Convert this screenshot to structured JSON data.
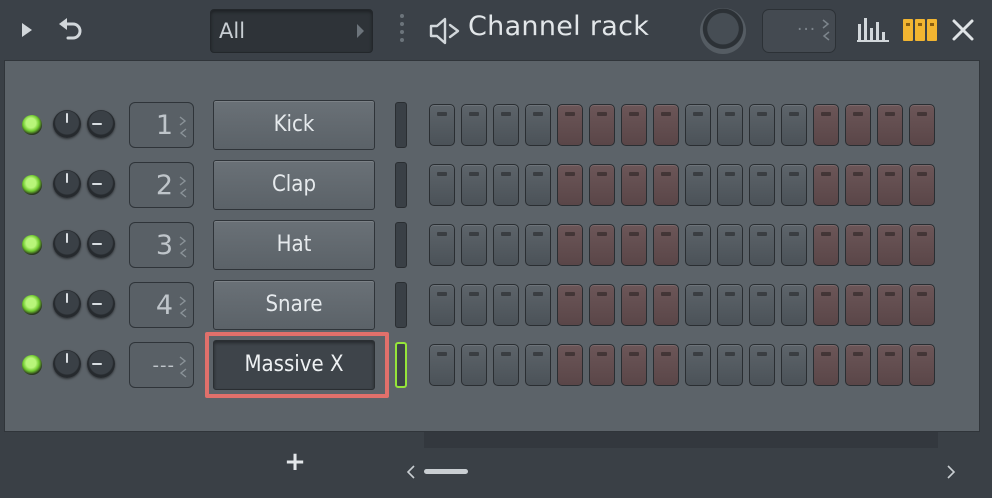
{
  "titlebar": {
    "filter_value": "All",
    "title": "Channel rack",
    "swing_value": "···"
  },
  "channels": [
    {
      "name": "Kick",
      "mixer_track": "1",
      "selected": false
    },
    {
      "name": "Clap",
      "mixer_track": "2",
      "selected": false
    },
    {
      "name": "Hat",
      "mixer_track": "3",
      "selected": false
    },
    {
      "name": "Snare",
      "mixer_track": "4",
      "selected": false
    },
    {
      "name": "Massive X",
      "mixer_track": "---",
      "selected": true
    }
  ],
  "steps_per_pattern": 16,
  "step_group_colors": [
    "gray",
    "red",
    "gray",
    "red"
  ],
  "bottom": {
    "add_label": "+"
  },
  "colors": {
    "led_green": "#6ec72d",
    "selection_outline": "#e0706b",
    "active_meter": "#95e53a",
    "step_gray": "#555c62",
    "step_red": "#634e50"
  }
}
